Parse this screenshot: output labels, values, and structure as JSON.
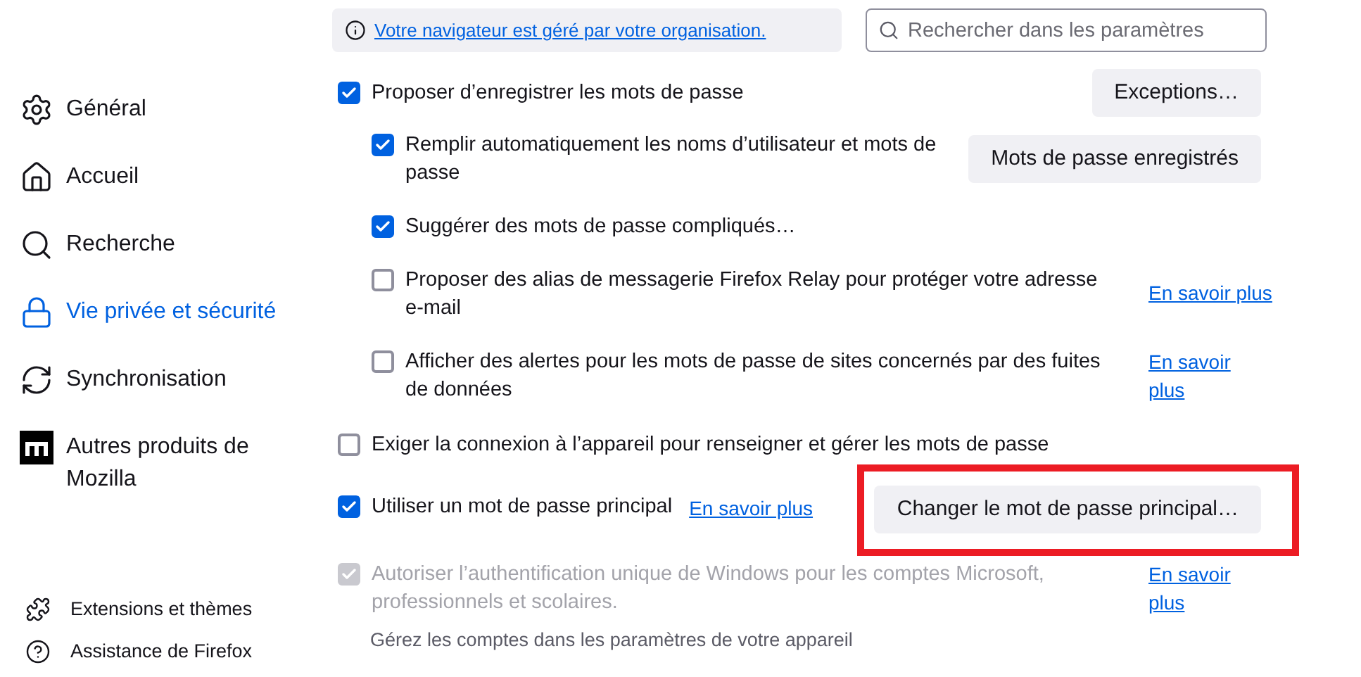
{
  "notice": {
    "text": "Votre navigateur est géré par votre organisation."
  },
  "search": {
    "placeholder": "Rechercher dans les paramètres"
  },
  "sidebar": {
    "items": [
      {
        "label": "Général",
        "selected": false
      },
      {
        "label": "Accueil",
        "selected": false
      },
      {
        "label": "Recherche",
        "selected": false
      },
      {
        "label": "Vie privée et sécurité",
        "selected": true
      },
      {
        "label": "Synchronisation",
        "selected": false
      },
      {
        "label": "Autres produits de Mozilla",
        "selected": false
      }
    ],
    "footer_items": [
      {
        "label": "Extensions et thèmes"
      },
      {
        "label": "Assistance de Firefox"
      }
    ]
  },
  "options": [
    {
      "kind": "checkbox",
      "label": "Proposer d’enregistrer les mots de passe",
      "checked": true,
      "disabled": false,
      "button": "Exceptions…",
      "children": [
        {
          "kind": "checkbox",
          "label": "Remplir automatiquement les noms d’utilisateur et mots de passe",
          "checked": true,
          "disabled": false,
          "button": "Mots de passe enregistrés"
        },
        {
          "kind": "checkbox",
          "label": "Suggérer des mots de passe compliqués…",
          "checked": true,
          "disabled": false
        },
        {
          "kind": "checkbox",
          "label": "Proposer des alias de messagerie Firefox Relay pour protéger votre adresse e-mail",
          "checked": false,
          "disabled": false,
          "link": "En savoir plus"
        },
        {
          "kind": "checkbox",
          "label": "Afficher des alertes pour les mots de passe de sites concernés par des fuites de données",
          "checked": false,
          "disabled": false,
          "link": "En savoir plus"
        }
      ]
    },
    {
      "kind": "checkbox",
      "label": "Exiger la connexion à l’appareil pour renseigner et gérer les mots de passe",
      "checked": false,
      "disabled": false
    },
    {
      "kind": "checkbox",
      "label": "Utiliser un mot de passe principal",
      "checked": true,
      "disabled": false,
      "inline_link": "En savoir plus",
      "button": "Changer le mot de passe principal…",
      "highlighted": true
    },
    {
      "kind": "checkbox",
      "label": "Autoriser l’authentification unique de Windows pour les comptes Microsoft, professionnels et scolaires.",
      "checked": true,
      "disabled": true,
      "link": "En savoir plus"
    },
    {
      "kind": "note",
      "label": "Gérez les comptes dans les paramètres de votre appareil"
    }
  ]
}
